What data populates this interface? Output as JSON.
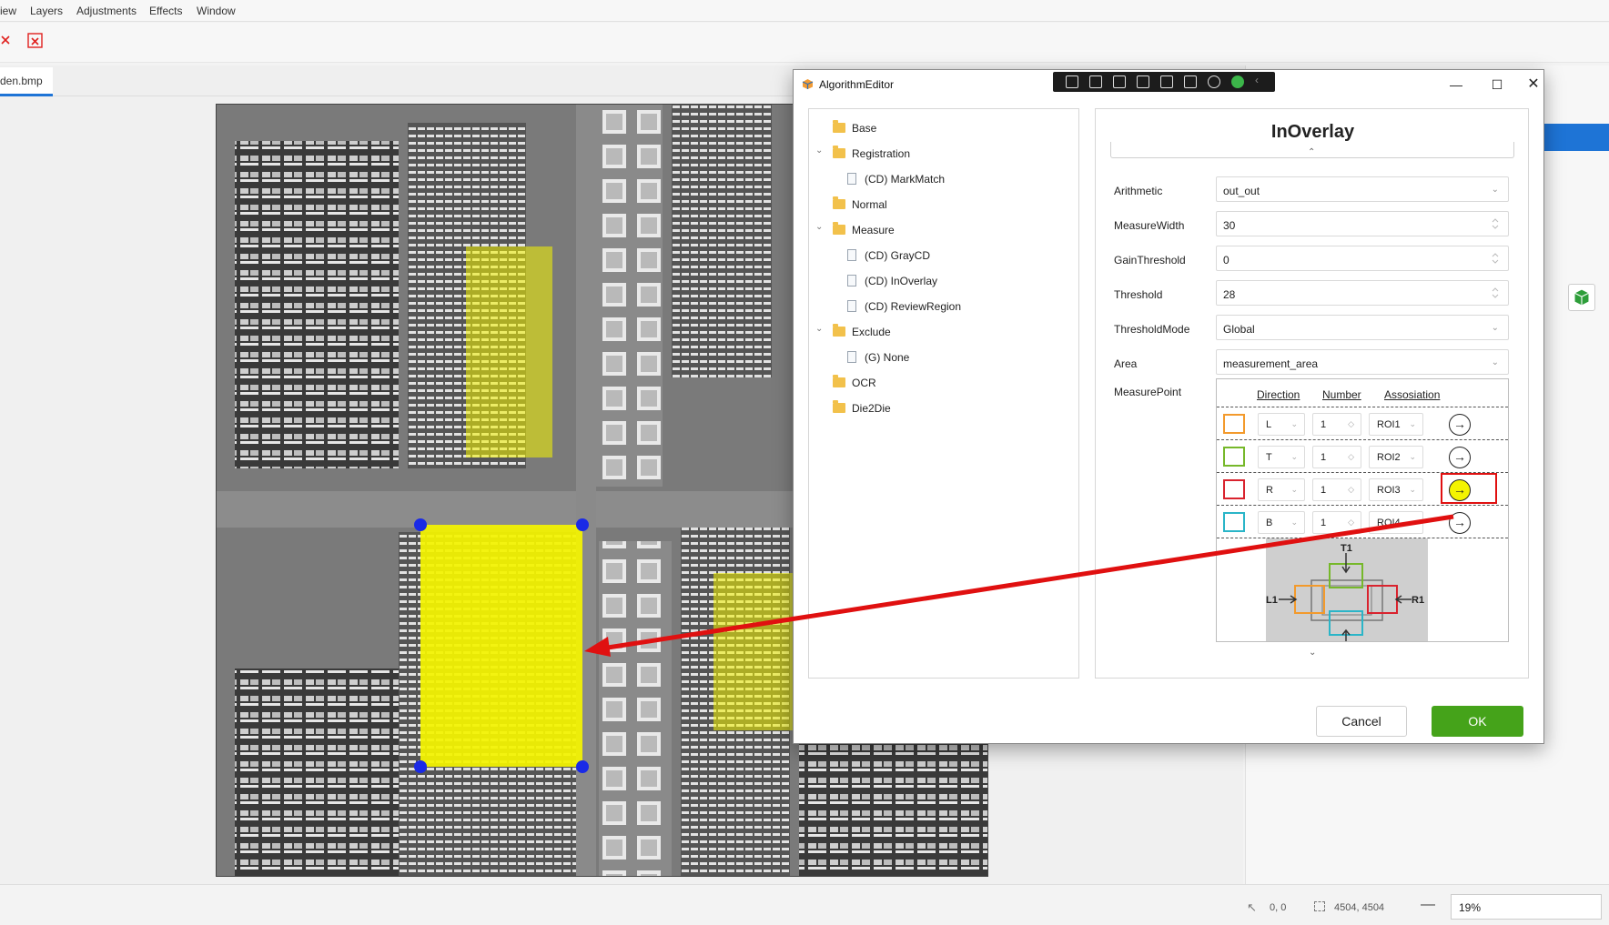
{
  "menu": [
    "iew",
    "Layers",
    "Adjustments",
    "Effects",
    "Window"
  ],
  "document_tab": "den.bmp",
  "status": {
    "cursor_pos": "0, 0",
    "image_size": "4504, 4504",
    "zoom": "19%"
  },
  "dialog": {
    "title": "AlgorithmEditor",
    "tree": [
      {
        "label": "Base",
        "type": "folder",
        "level": 0
      },
      {
        "label": "Registration",
        "type": "folder",
        "level": 0,
        "expanded": true
      },
      {
        "label": "(CD) MarkMatch",
        "type": "file",
        "level": 1
      },
      {
        "label": "Normal",
        "type": "folder",
        "level": 0
      },
      {
        "label": "Measure",
        "type": "folder",
        "level": 0,
        "expanded": true
      },
      {
        "label": "(CD) GrayCD",
        "type": "file",
        "level": 1
      },
      {
        "label": "(CD) InOverlay",
        "type": "file",
        "level": 1
      },
      {
        "label": "(CD) ReviewRegion",
        "type": "file",
        "level": 1
      },
      {
        "label": "Exclude",
        "type": "folder",
        "level": 0,
        "expanded": true
      },
      {
        "label": "(G) None",
        "type": "file",
        "level": 1
      },
      {
        "label": "OCR",
        "type": "folder",
        "level": 0
      },
      {
        "label": "Die2Die",
        "type": "folder",
        "level": 0
      }
    ],
    "props": {
      "title": "InOverlay",
      "arithmetic": {
        "label": "Arithmetic",
        "value": "out_out"
      },
      "measure_width": {
        "label": "MeasureWidth",
        "value": "30"
      },
      "gain_threshold": {
        "label": "GainThreshold",
        "value": "0"
      },
      "threshold": {
        "label": "Threshold",
        "value": "28"
      },
      "threshold_mode": {
        "label": "ThresholdMode",
        "value": "Global"
      },
      "area": {
        "label": "Area",
        "value": "measurement_area"
      },
      "measure_point": {
        "label": "MeasurePoint",
        "headers": {
          "direction": "Direction",
          "number": "Number",
          "association": "Assosiation"
        },
        "rows": [
          {
            "color": "#f39a2c",
            "direction": "L",
            "number": "1",
            "roi": "ROI1",
            "active": false
          },
          {
            "color": "#76b82a",
            "direction": "T",
            "number": "1",
            "roi": "ROI2",
            "active": false
          },
          {
            "color": "#d9232e",
            "direction": "R",
            "number": "1",
            "roi": "ROI3",
            "active": true
          },
          {
            "color": "#2ab5c8",
            "direction": "B",
            "number": "1",
            "roi": "ROI4",
            "active": false
          }
        ],
        "diagram": {
          "t1": "T1",
          "l1": "L1",
          "r1": "R1"
        }
      }
    },
    "buttons": {
      "cancel": "Cancel",
      "ok": "OK"
    }
  },
  "colors": {
    "ok_green": "#45a31a",
    "highlight_red": "#e01010",
    "roi_yellow": "#f4f400",
    "handle_blue": "#1a2ae6"
  }
}
